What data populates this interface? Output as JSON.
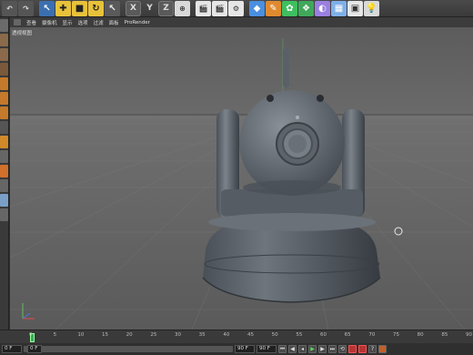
{
  "toolbar": {
    "axis_x": "X",
    "axis_y": "Y",
    "axis_z": "Z"
  },
  "viewport_menu": {
    "items": [
      "查看",
      "摄像机",
      "显示",
      "选项",
      "过滤",
      "面板",
      "ProRender"
    ]
  },
  "viewport": {
    "label": "透视视图"
  },
  "timeline": {
    "ticks": [
      "0",
      "5",
      "10",
      "15",
      "20",
      "25",
      "30",
      "35",
      "40",
      "45",
      "50",
      "55",
      "60",
      "65",
      "70",
      "75",
      "80",
      "85",
      "90"
    ],
    "current_frame": "0"
  },
  "bottom": {
    "start_frame": "0 F",
    "preview_start": "0 F",
    "preview_end": "90 F",
    "end_frame": "90 F"
  },
  "colors": {
    "toolbar_bg": "#3f3f3f",
    "viewport_bg": "#5a5a5a",
    "accent_green": "#2fae5e"
  }
}
